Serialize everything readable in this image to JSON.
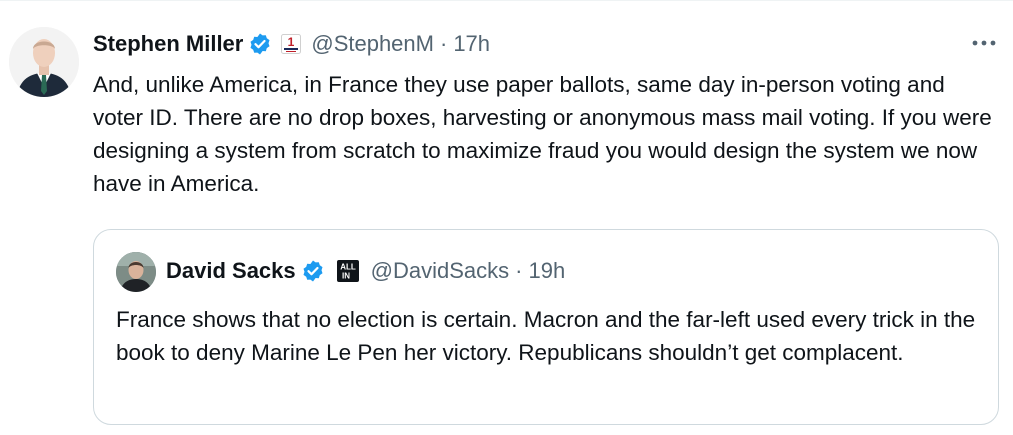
{
  "tweet": {
    "author_name": "Stephen Miller",
    "handle": "@StephenM",
    "separator": "·",
    "time": "17h",
    "text": "And, unlike America, in France they use paper ballots, same day in-person voting and voter ID. There are no drop boxes, harvesting or anonymous mass mail voting. If you were designing a system from scratch to maximize fraud you would design the system we now have in America.",
    "affiliation_badge_text": "1",
    "more_icon": "more-dots-icon",
    "verified_color": "#1d9bf0"
  },
  "quoted_tweet": {
    "author_name": "David Sacks",
    "handle": "@DavidSacks",
    "separator": "·",
    "time": "19h",
    "text": "France shows that no election is certain. Macron and the far-left used every trick in the book to deny Marine Le Pen her victory. Republicans shouldn’t get complacent.",
    "affiliation_badge_text_top": "ALL",
    "affiliation_badge_text_bottom": "IN"
  },
  "colors": {
    "text": "#0f1419",
    "secondary": "#536471",
    "border": "#cfd9de",
    "verified": "#1d9bf0"
  }
}
